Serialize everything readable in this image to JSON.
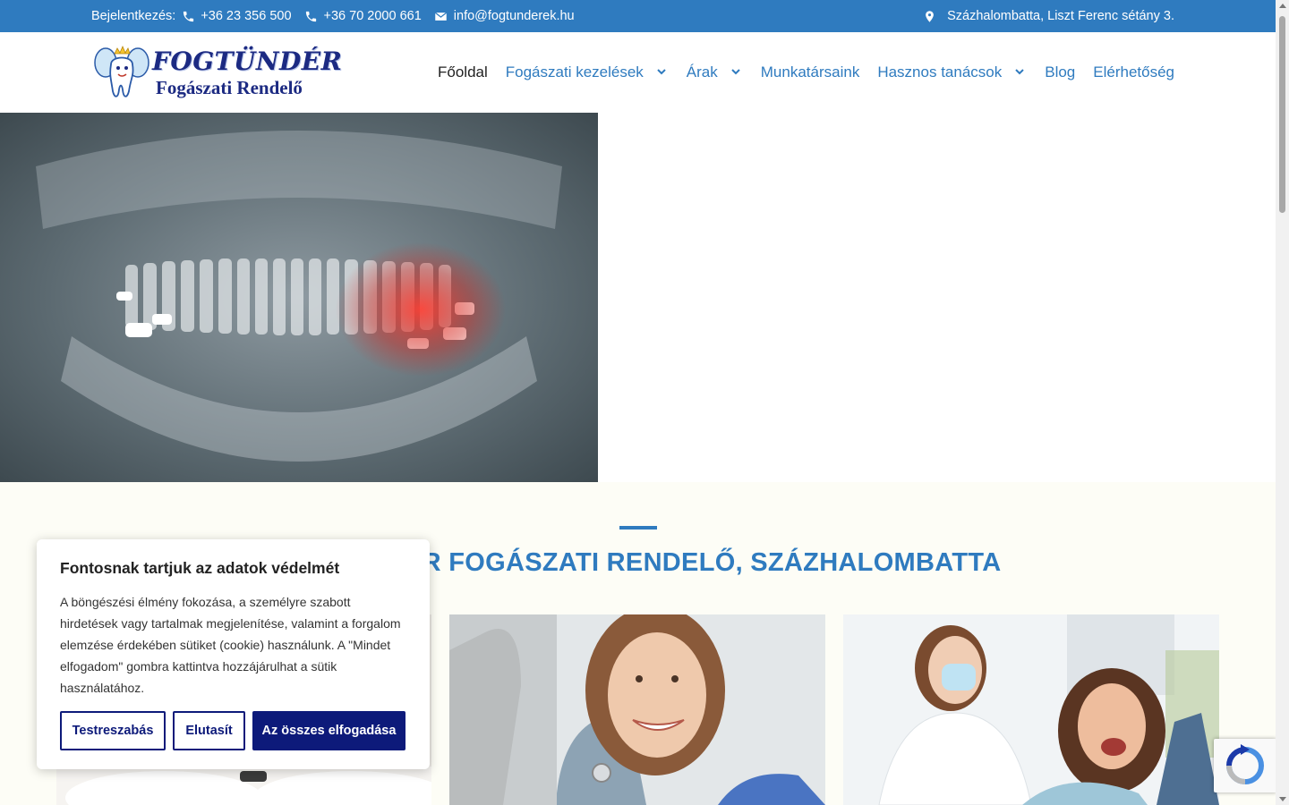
{
  "topbar": {
    "login_label": "Bejelentkezés:",
    "phone1": "+36 23 356 500",
    "phone2": "+36 70 2000 661",
    "email": "info@fogtunderek.hu",
    "address": "Százhalombatta, Liszt Ferenc sétány 3."
  },
  "logo": {
    "title": "FOGTÜNDÉR",
    "subtitle": "Fogászati Rendelő"
  },
  "nav": {
    "items": [
      {
        "label": "Főoldal",
        "active": true,
        "dropdown": false
      },
      {
        "label": "Fogászati kezelések",
        "active": false,
        "dropdown": true
      },
      {
        "label": "Árak",
        "active": false,
        "dropdown": true
      },
      {
        "label": "Munkatársaink",
        "active": false,
        "dropdown": false
      },
      {
        "label": "Hasznos tanácsok",
        "active": false,
        "dropdown": true
      },
      {
        "label": "Blog",
        "active": false,
        "dropdown": false
      },
      {
        "label": "Elérhetőség",
        "active": false,
        "dropdown": false
      }
    ]
  },
  "section": {
    "heading": "FOGTÜNDÉR FOGÁSZATI RENDELŐ, SZÁZHALOMBATTA"
  },
  "cookie": {
    "title": "Fontosnak tartjuk az adatok védelmét",
    "text": "A böngészési élmény fokozása, a személyre szabott hirdetések vagy tartalmak megjelenítése, valamint a forgalom elemzése érdekében sütiket (cookie) használunk. A \"Mindet elfogadom\" gombra kattintva hozzájárulhat a sütik használatához.",
    "btn_customize": "Testreszabás",
    "btn_reject": "Elutasít",
    "btn_accept": "Az összes elfogadása"
  },
  "colors": {
    "brand_blue": "#2f7bbf",
    "cookie_navy": "#0d1a7a",
    "logo_navy": "#1c2a82"
  }
}
